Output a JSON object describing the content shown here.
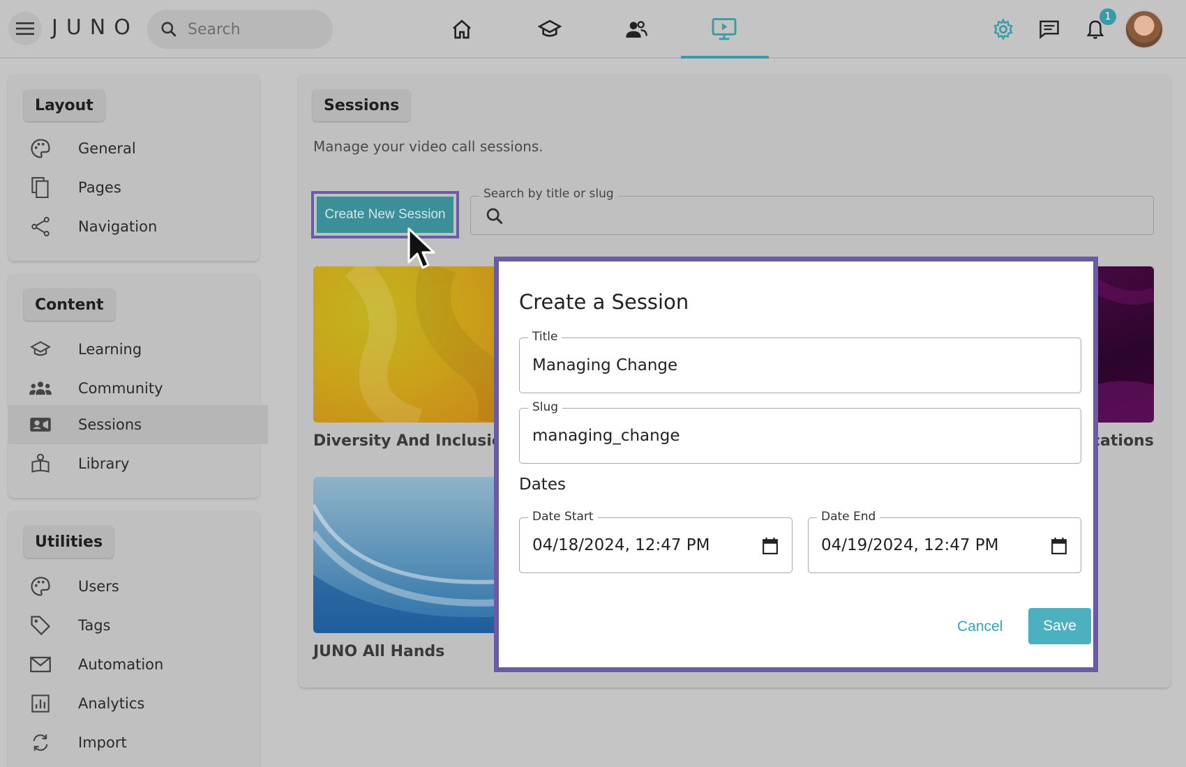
{
  "app": {
    "logo": "JUNO"
  },
  "header": {
    "search_placeholder": "Search",
    "nav": [
      "home-icon",
      "learning-icon",
      "community-icon",
      "sessions-icon"
    ],
    "notification_count": "1"
  },
  "sidebar": {
    "layout": {
      "title": "Layout",
      "items": [
        {
          "label": "General",
          "icon": "palette-icon"
        },
        {
          "label": "Pages",
          "icon": "pages-icon"
        },
        {
          "label": "Navigation",
          "icon": "share-icon"
        }
      ]
    },
    "content": {
      "title": "Content",
      "items": [
        {
          "label": "Learning",
          "icon": "learning-icon"
        },
        {
          "label": "Community",
          "icon": "community-icon"
        },
        {
          "label": "Sessions",
          "icon": "video-icon",
          "active": true
        },
        {
          "label": "Library",
          "icon": "library-icon"
        }
      ]
    },
    "utilities": {
      "title": "Utilities",
      "items": [
        {
          "label": "Users",
          "icon": "palette-icon"
        },
        {
          "label": "Tags",
          "icon": "tag-icon"
        },
        {
          "label": "Automation",
          "icon": "mail-icon"
        },
        {
          "label": "Analytics",
          "icon": "analytics-icon"
        },
        {
          "label": "Import",
          "icon": "sync-icon"
        }
      ]
    }
  },
  "main": {
    "title": "Sessions",
    "subtitle": "Manage your video call sessions.",
    "create_button": "Create New Session",
    "search_label": "Search by title or slug",
    "tiles": [
      {
        "title": "Diversity And Inclusion"
      },
      {
        "title": "cations"
      },
      {
        "title": "JUNO All Hands"
      }
    ]
  },
  "modal": {
    "title": "Create a Session",
    "title_label": "Title",
    "title_value": "Managing Change",
    "slug_label": "Slug",
    "slug_value": "managing_change",
    "dates_heading": "Dates",
    "date_start_label": "Date Start",
    "date_start_value": "04/18/2024, 12:47 PM",
    "date_end_label": "Date End",
    "date_end_value": "04/19/2024, 12:47 PM",
    "cancel": "Cancel",
    "save": "Save"
  },
  "colors": {
    "accent": "#3a9aa6",
    "highlight": "#6b5aa6",
    "save": "#4db0be"
  }
}
